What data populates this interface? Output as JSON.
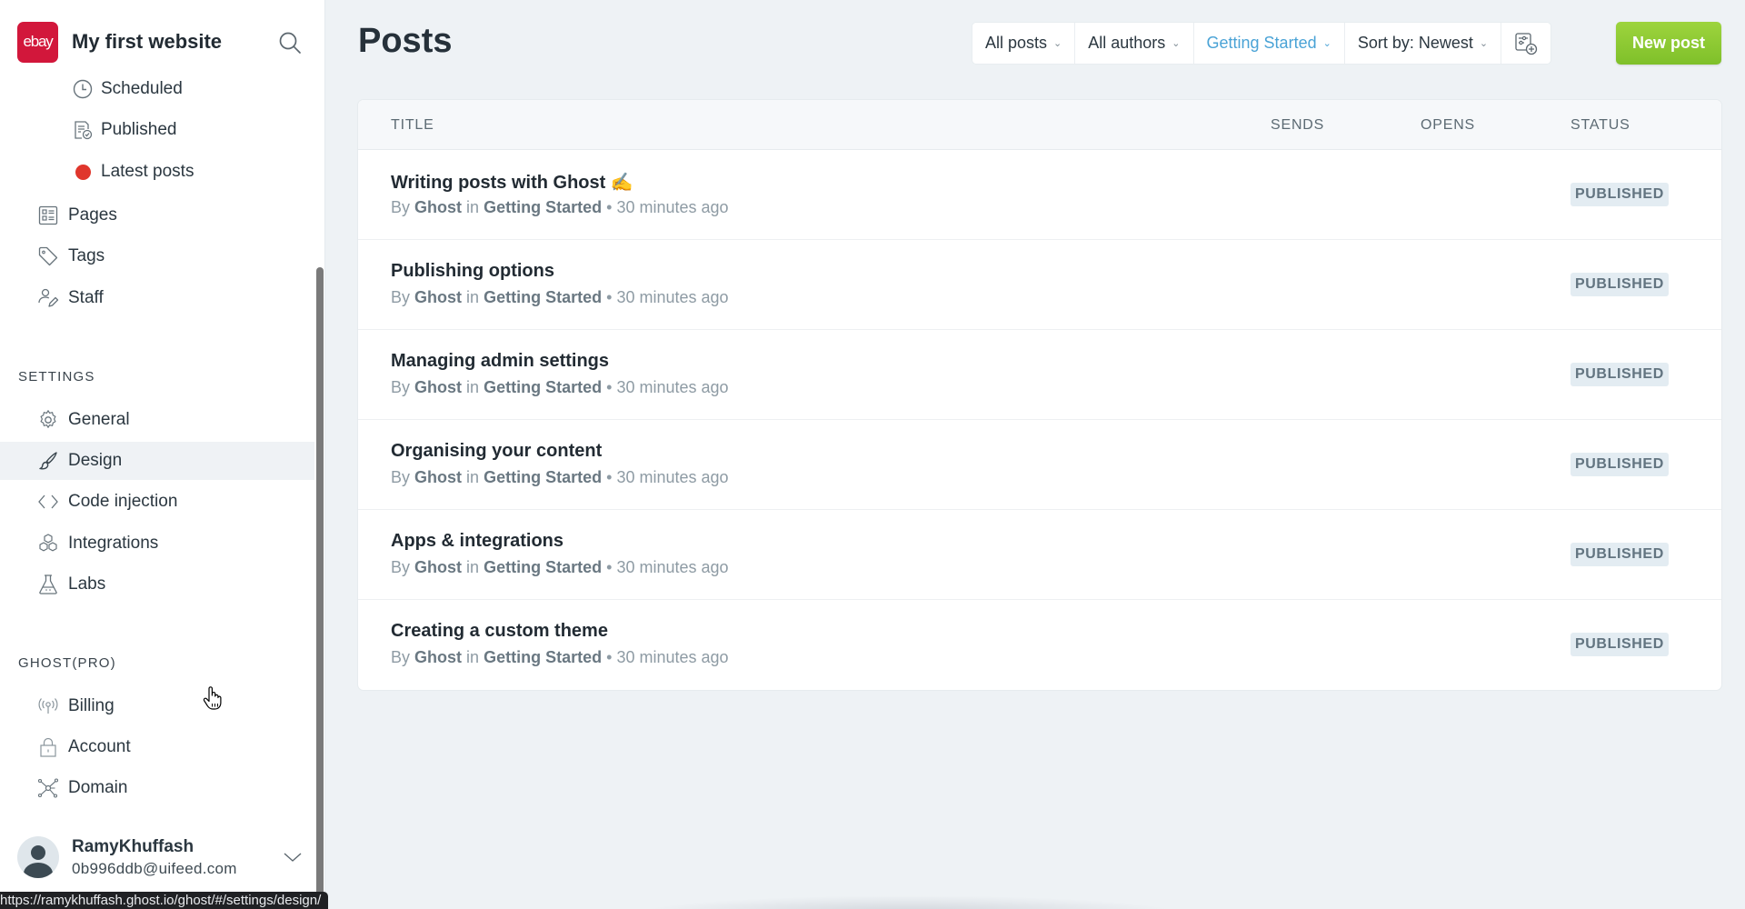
{
  "sidebar": {
    "brand": {
      "logo_text": "ebay",
      "title": "My first website",
      "logo_color": "#d2173b"
    },
    "post_subitems": [
      {
        "label": "Scheduled",
        "icon": "clock-icon"
      },
      {
        "label": "Published",
        "icon": "published-document-icon"
      },
      {
        "label": "Latest posts",
        "icon": "red-dot-icon"
      }
    ],
    "main_items": [
      {
        "label": "Pages",
        "icon": "pages-icon"
      },
      {
        "label": "Tags",
        "icon": "tag-icon"
      },
      {
        "label": "Staff",
        "icon": "staff-icon"
      }
    ],
    "settings": {
      "heading": "SETTINGS",
      "items": [
        {
          "label": "General",
          "icon": "gear-icon"
        },
        {
          "label": "Design",
          "icon": "brush-icon",
          "active": true
        },
        {
          "label": "Code injection",
          "icon": "code-icon"
        },
        {
          "label": "Integrations",
          "icon": "integrations-icon"
        },
        {
          "label": "Labs",
          "icon": "flask-icon"
        }
      ]
    },
    "ghost_pro": {
      "heading": "GHOST(PRO)",
      "items": [
        {
          "label": "Billing",
          "icon": "broadcast-icon"
        },
        {
          "label": "Account",
          "icon": "lock-icon"
        },
        {
          "label": "Domain",
          "icon": "network-icon"
        }
      ]
    },
    "user": {
      "name": "RamyKhuffash",
      "email": "0b996ddb@uifeed.com"
    }
  },
  "status_bar_url": "https://ramykhuffash.ghost.io/ghost/#/settings/design/",
  "main": {
    "title": "Posts",
    "filters": [
      {
        "label": "All posts"
      },
      {
        "label": "All authors"
      },
      {
        "label": "Getting Started",
        "active": true
      },
      {
        "label": "Sort by: Newest"
      }
    ],
    "new_post_label": "New post",
    "accent_color": "#4aa3d6",
    "button_color": "#8ac933",
    "table": {
      "columns": [
        "TITLE",
        "SENDS",
        "OPENS",
        "STATUS"
      ],
      "rows": [
        {
          "title": "Writing posts with Ghost ✍️",
          "by": "By",
          "author": "Ghost",
          "in": "in",
          "tag": "Getting Started",
          "sep": "•",
          "time": "30 minutes ago",
          "sends": "",
          "opens": "",
          "status": "PUBLISHED"
        },
        {
          "title": "Publishing options",
          "by": "By",
          "author": "Ghost",
          "in": "in",
          "tag": "Getting Started",
          "sep": "•",
          "time": "30 minutes ago",
          "sends": "",
          "opens": "",
          "status": "PUBLISHED"
        },
        {
          "title": "Managing admin settings",
          "by": "By",
          "author": "Ghost",
          "in": "in",
          "tag": "Getting Started",
          "sep": "•",
          "time": "30 minutes ago",
          "sends": "",
          "opens": "",
          "status": "PUBLISHED"
        },
        {
          "title": "Organising your content",
          "by": "By",
          "author": "Ghost",
          "in": "in",
          "tag": "Getting Started",
          "sep": "•",
          "time": "30 minutes ago",
          "sends": "",
          "opens": "",
          "status": "PUBLISHED"
        },
        {
          "title": "Apps & integrations",
          "by": "By",
          "author": "Ghost",
          "in": "in",
          "tag": "Getting Started",
          "sep": "•",
          "time": "30 minutes ago",
          "sends": "",
          "opens": "",
          "status": "PUBLISHED"
        },
        {
          "title": "Creating a custom theme",
          "by": "By",
          "author": "Ghost",
          "in": "in",
          "tag": "Getting Started",
          "sep": "•",
          "time": "30 minutes ago",
          "sends": "",
          "opens": "",
          "status": "PUBLISHED"
        }
      ]
    }
  }
}
